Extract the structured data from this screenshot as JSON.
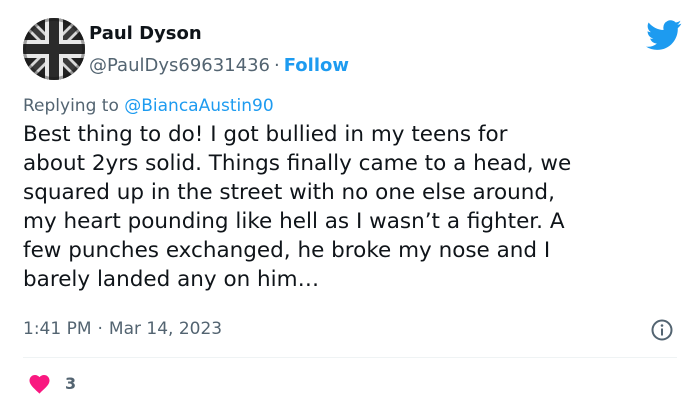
{
  "author": {
    "display_name": "Paul Dyson",
    "handle": "@PaulDys69631436",
    "separator": "·",
    "follow_label": "Follow"
  },
  "reply": {
    "prefix": "Replying to",
    "handle": "@BiancaAustin90"
  },
  "tweet": {
    "lines": [
      "Best thing to do! I got bullied in my teens for",
      "about 2yrs solid. Things finally came to a head, we",
      "squared up in the street with no one else around,",
      "my heart pounding like hell as I wasn’t a fighter. A",
      "few punches exchanged, he broke my nose and I",
      "barely landed any on him…"
    ]
  },
  "meta": {
    "time": "1:41 PM",
    "separator": "·",
    "date": "Mar 14, 2023"
  },
  "engagement": {
    "like_count": "3"
  },
  "icons": {
    "brand": "twitter-bird-icon",
    "info": "info-icon",
    "like": "heart-icon"
  },
  "colors": {
    "accent": "#1d9bf0",
    "text": "#0f1419",
    "secondary": "#536471",
    "like": "#f91880"
  }
}
